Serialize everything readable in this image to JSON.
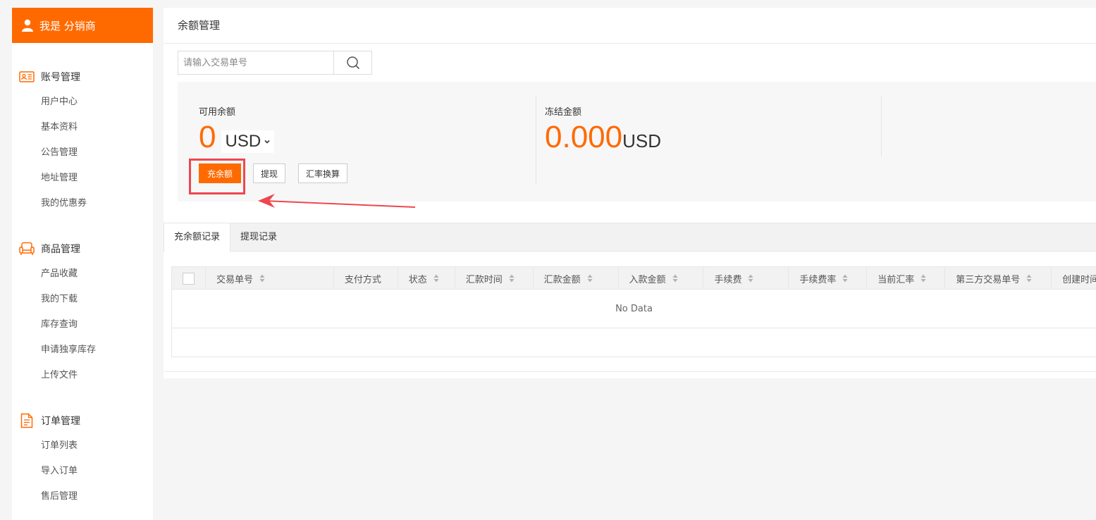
{
  "sidebar": {
    "brand": "我是 分销商",
    "groups": [
      {
        "title": "账号管理",
        "icon": "id-card-icon",
        "items": [
          "用户中心",
          "基本资料",
          "公告管理",
          "地址管理",
          "我的优惠券"
        ]
      },
      {
        "title": "商品管理",
        "icon": "sofa-icon",
        "items": [
          "产品收藏",
          "我的下载",
          "库存查询",
          "申请独享库存",
          "上传文件"
        ]
      },
      {
        "title": "订单管理",
        "icon": "document-icon",
        "items": [
          "订单列表",
          "导入订单",
          "售后管理"
        ]
      }
    ]
  },
  "page": {
    "title": "余额管理",
    "search_placeholder": "请输入交易单号"
  },
  "balance": {
    "available_label": "可用余额",
    "available_value": "0",
    "currency": "USD",
    "frozen_label": "冻结金额",
    "frozen_value": "0.000",
    "frozen_currency": "USD",
    "buttons": {
      "recharge": "充余额",
      "withdraw": "提现",
      "exchange": "汇率换算"
    }
  },
  "tabs": [
    "充余额记录",
    "提现记录"
  ],
  "table": {
    "columns": [
      "交易单号",
      "支付方式",
      "状态",
      "汇款时间",
      "汇款金额",
      "入款金额",
      "手续费",
      "手续费率",
      "当前汇率",
      "第三方交易单号",
      "创建时间"
    ],
    "empty_text": "No Data"
  },
  "colors": {
    "accent": "#ff6a00",
    "highlight": "#f0464f"
  }
}
